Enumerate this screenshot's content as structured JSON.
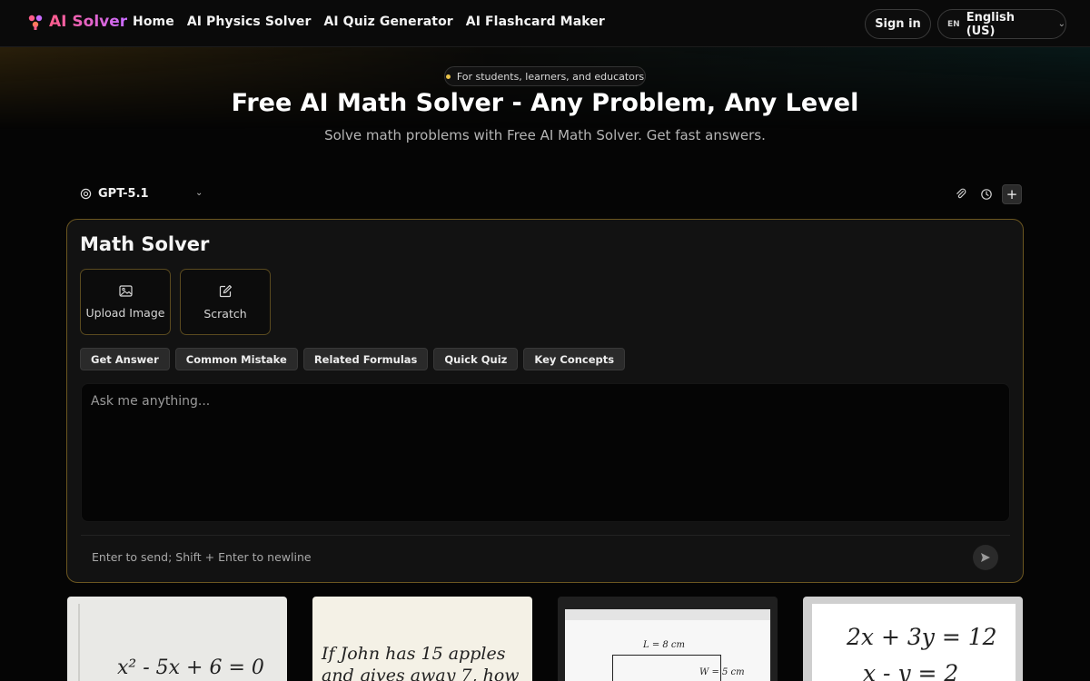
{
  "brand": {
    "name": "AI Solver"
  },
  "nav": {
    "items": [
      "Home",
      "AI Physics Solver",
      "AI Quiz Generator",
      "AI Flashcard Maker"
    ]
  },
  "header": {
    "sign_in": "Sign in",
    "lang_code": "EN",
    "lang_label": "English (US)"
  },
  "hero": {
    "pill": "For students, learners, and educators",
    "title": "Free AI Math Solver - Any Problem, Any Level",
    "subtitle": "Solve math problems with Free AI Math Solver. Get fast answers."
  },
  "model": {
    "name": "GPT-5.1"
  },
  "panel": {
    "title": "Math Solver",
    "cards": [
      "Upload Image",
      "Scratch"
    ],
    "chips": [
      "Get Answer",
      "Common Mistake",
      "Related Formulas",
      "Quick Quiz",
      "Key Concepts"
    ],
    "placeholder": "Ask me anything...",
    "hint": "Enter to send; Shift + Enter to newline"
  },
  "examples": [
    {
      "text": "x² - 5x + 6 = 0"
    },
    {
      "text": "If John has 15 apples",
      "text2": "and gives away 7, how many"
    },
    {
      "text": "L = 8 cm",
      "text2": "W = 5 cm"
    },
    {
      "text": "2x + 3y = 12",
      "text2": "x - y = 2"
    }
  ],
  "colors": {
    "accent": "#ff5c8a",
    "panel_border": "#6b5620",
    "background": "#050505"
  }
}
